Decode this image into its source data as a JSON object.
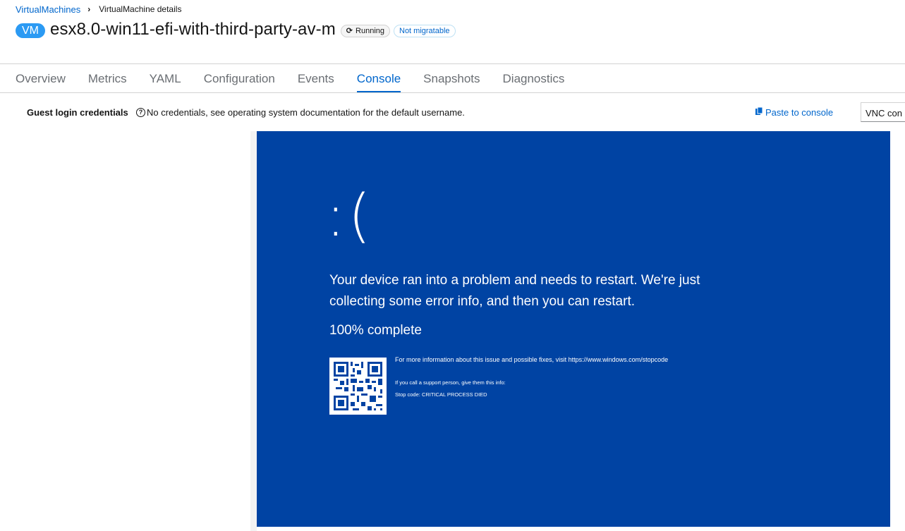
{
  "breadcrumb": {
    "parent": "VirtualMachines",
    "current": "VirtualMachine details"
  },
  "header": {
    "badge": "VM",
    "name": "esx8.0-win11-efi-with-third-party-av-m",
    "status": "Running",
    "migration": "Not migratable"
  },
  "tabs": [
    {
      "label": "Overview"
    },
    {
      "label": "Metrics"
    },
    {
      "label": "YAML"
    },
    {
      "label": "Configuration"
    },
    {
      "label": "Events"
    },
    {
      "label": "Console"
    },
    {
      "label": "Snapshots"
    },
    {
      "label": "Diagnostics"
    }
  ],
  "console": {
    "credentials_label": "Guest login credentials",
    "credentials_help": "No credentials, see operating system documentation for the default username.",
    "paste_label": "Paste to console",
    "console_type": "VNC con"
  },
  "bsod": {
    "face": ":(",
    "message": "Your device ran into a problem and needs to restart. We're just collecting some error info, and then you can restart.",
    "progress": "100% complete",
    "info_url_line": "For more information about this issue and possible fixes, visit https://www.windows.com/stopcode",
    "support_line": "If you call a support person, give them this info:",
    "stop_code": "Stop code: CRITICAL PROCESS DIED",
    "background": "#0043a3"
  },
  "colors": {
    "accent": "#0066cc",
    "vm_badge": "#2b9af3"
  }
}
